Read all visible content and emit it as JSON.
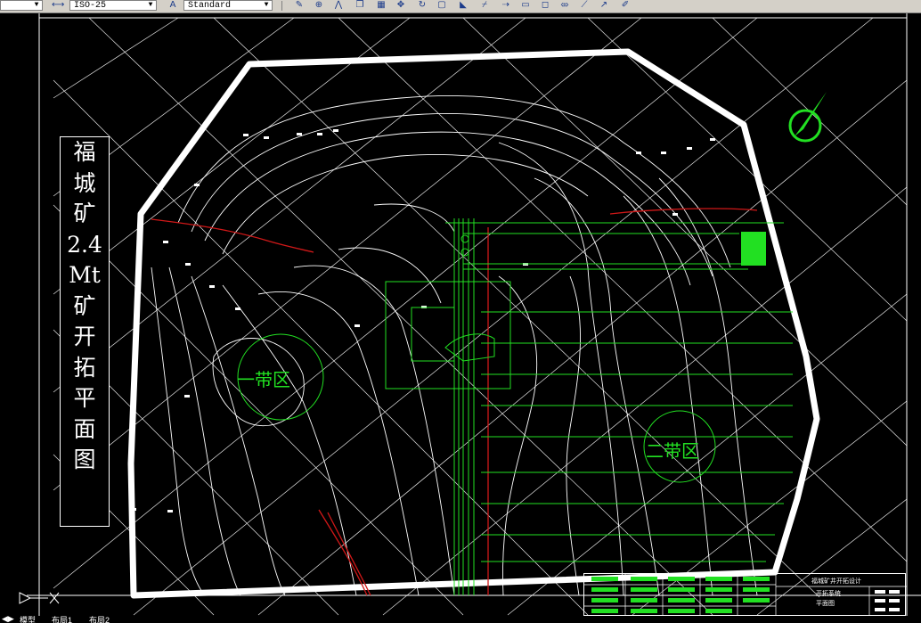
{
  "toolbar": {
    "dim_style": "ISO-25",
    "text_style": "Standard",
    "icons": [
      "dimension-style-icon",
      "text-style-icon",
      "edit-icon",
      "move-icon",
      "mirror-icon",
      "copy-icon",
      "array-icon",
      "pan-icon",
      "rotate-icon",
      "scale-icon",
      "stretch-icon",
      "trim-icon",
      "extend-icon",
      "break-icon",
      "chamfer-icon",
      "fillet-icon",
      "explode-icon"
    ]
  },
  "drawing": {
    "title_chars": [
      "福",
      "城",
      "矿",
      "2.4",
      "Mt",
      "矿",
      "开",
      "拓",
      "平",
      "面",
      "图"
    ],
    "zone_1": "一带区",
    "zone_2": "二带区",
    "title_block": {
      "header": "福城矿井开拓设计",
      "line1": "开拓系统",
      "line2": "平面图"
    },
    "colors": {
      "background": "#000000",
      "contour": "#ffffff",
      "roadway": "#22e022",
      "fault": "#d01818"
    }
  },
  "tabs": {
    "model": "模型",
    "layout1": "布局1",
    "layout2": "布局2"
  }
}
